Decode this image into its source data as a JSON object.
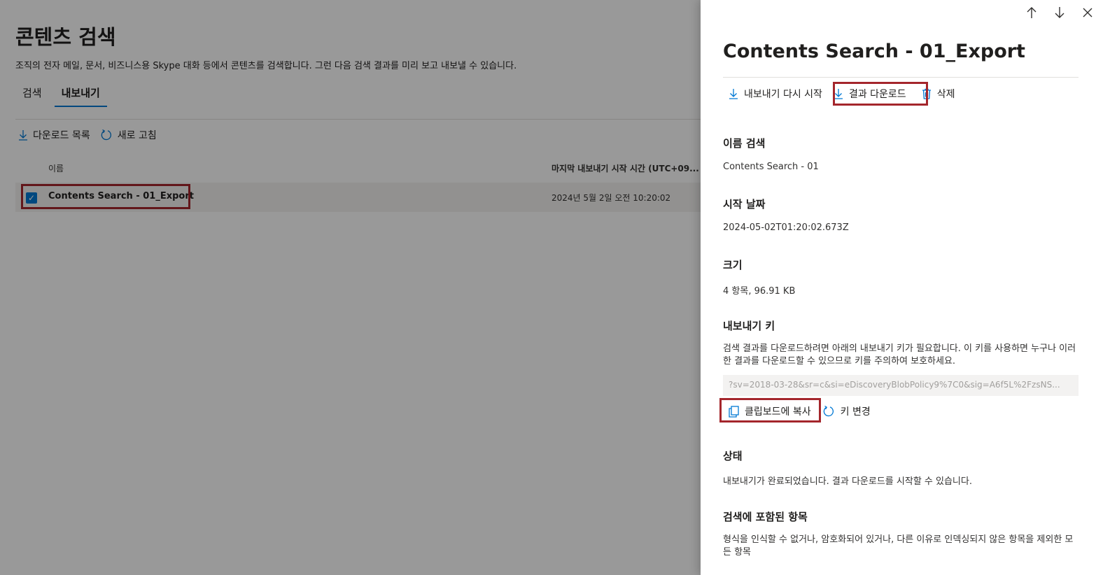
{
  "page": {
    "title": "콘텐츠 검색",
    "description": "조직의 전자 메일, 문서, 비즈니스용 Skype 대화 등에서 콘텐츠를 검색합니다. 그런 다음 검색 결과를 미리 보고 내보낼 수 있습니다.",
    "tabs": [
      {
        "label": "검색",
        "active": false
      },
      {
        "label": "내보내기",
        "active": true
      }
    ],
    "commands": {
      "download_list": "다운로드 목록",
      "refresh": "새로 고침"
    },
    "table": {
      "columns": [
        "이름",
        "마지막 내보내기 시작 시간 (UTC+09..."
      ],
      "rows": [
        {
          "name": "Contents Search - 01_Export",
          "time": "2024년 5월 2일 오전 10:20:02",
          "selected": true
        }
      ]
    }
  },
  "panel": {
    "title": "Contents Search - 01_Export",
    "commands": {
      "restart_export": "내보내기 다시 시작",
      "download_results": "결과 다운로드",
      "delete": "삭제"
    },
    "sections": {
      "name_label": "이름 검색",
      "name_value": "Contents Search - 01",
      "start_label": "시작 날짜",
      "start_value": "2024-05-02T01:20:02.673Z",
      "size_label": "크기",
      "size_value": "4 항목, 96.91 KB",
      "key_label": "내보내기 키",
      "key_desc": "검색 결과를 다운로드하려면 아래의 내보내기 키가 필요합니다. 이 키를 사용하면 누구나 이러한 결과를 다운로드할 수 있으므로 키를 주의하여 보호하세요.",
      "key_value": "?sv=2018-03-28&sr=c&si=eDiscoveryBlobPolicy9%7C0&sig=A6f5L%2FzsNS...",
      "copy_clipboard": "클립보드에 복사",
      "change_key": "키 변경",
      "status_label": "상태",
      "status_value": "내보내기가 완료되었습니다. 결과 다운로드를 시작할 수 있습니다.",
      "included_label": "검색에 포함된 항목",
      "included_value": "형식을 인식할 수 없거나, 암호화되어 있거나, 다른 이유로 인덱싱되지 않은 항목을 제외한 모든 항목"
    }
  },
  "colors": {
    "accent": "#0078d4",
    "highlight": "#a4262c"
  }
}
